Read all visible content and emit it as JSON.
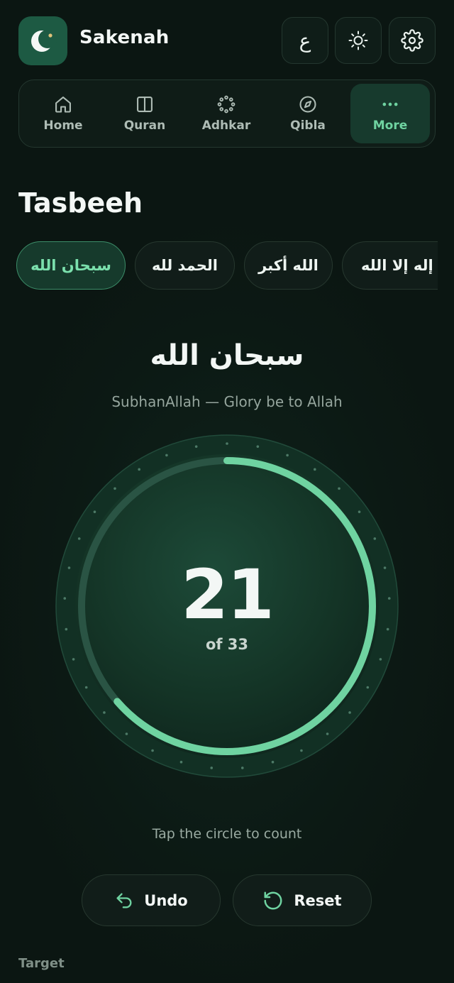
{
  "app": {
    "name": "Sakenah"
  },
  "header": {
    "language_label": "ع"
  },
  "nav": {
    "items": [
      {
        "label": "Home",
        "icon": "home-icon"
      },
      {
        "label": "Quran",
        "icon": "book-icon"
      },
      {
        "label": "Adhkar",
        "icon": "beads-icon"
      },
      {
        "label": "Qibla",
        "icon": "compass-icon"
      },
      {
        "label": "More",
        "icon": "more-icon",
        "active": true
      }
    ]
  },
  "page": {
    "title": "Tasbeeh"
  },
  "chips": [
    {
      "label": "سبحان الله",
      "active": true
    },
    {
      "label": "الحمد لله"
    },
    {
      "label": "الله أكبر"
    },
    {
      "label": "لا إله إلا الله"
    }
  ],
  "dhikr": {
    "arabic": "سبحان الله",
    "transliteration": "SubhanAllah — Glory be to Allah"
  },
  "counter": {
    "count": "21",
    "target_label": "of 33",
    "progress": 0.636
  },
  "hint": "Tap the circle to count",
  "actions": {
    "undo_label": "Undo",
    "reset_label": "Reset"
  },
  "footer": {
    "section_label": "Target"
  },
  "colors": {
    "accent": "#6fd3a1",
    "background": "#0b1612",
    "logo_bg": "#1d5a43"
  }
}
